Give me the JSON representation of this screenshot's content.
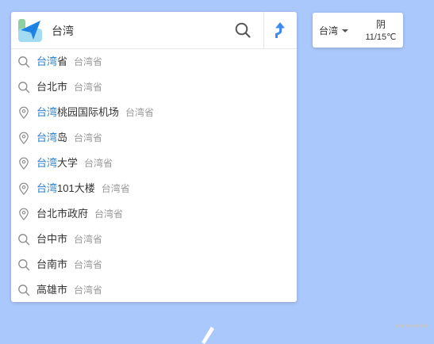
{
  "search": {
    "value": "台湾",
    "placeholder": ""
  },
  "suggestions": [
    {
      "icon": "search-icon",
      "highlight": "台湾",
      "rest": "省",
      "region": "台湾省"
    },
    {
      "icon": "search-icon",
      "highlight": "",
      "rest": "台北市",
      "region": "台湾省"
    },
    {
      "icon": "location-pin-icon",
      "highlight": "台湾",
      "rest": "桃园国际机场",
      "region": "台湾省"
    },
    {
      "icon": "location-pin-icon",
      "highlight": "台湾",
      "rest": "岛",
      "region": "台湾省"
    },
    {
      "icon": "location-pin-icon",
      "highlight": "台湾",
      "rest": "大学",
      "region": "台湾省"
    },
    {
      "icon": "location-pin-icon",
      "highlight": "台湾",
      "rest": "101大楼",
      "region": "台湾省"
    },
    {
      "icon": "location-pin-icon",
      "highlight": "",
      "rest": "台北市政府",
      "region": "台湾省"
    },
    {
      "icon": "search-icon",
      "highlight": "",
      "rest": "台中市",
      "region": "台湾省"
    },
    {
      "icon": "search-icon",
      "highlight": "",
      "rest": "台南市",
      "region": "台湾省"
    },
    {
      "icon": "search-icon",
      "highlight": "",
      "rest": "高雄市",
      "region": "台湾省"
    }
  ],
  "weather": {
    "city": "台湾",
    "condition": "阴",
    "temperature": "11/15℃"
  },
  "colors": {
    "map_background": "#aac8fb",
    "highlight": "#2a7ec9",
    "route_accent": "#3d8bf2"
  }
}
